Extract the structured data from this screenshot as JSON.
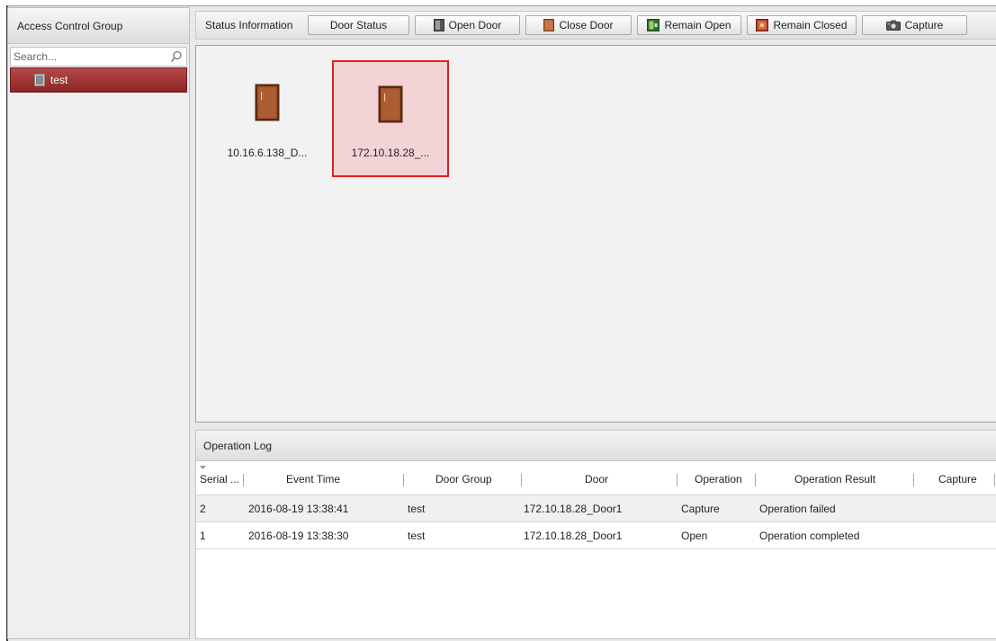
{
  "sidebar": {
    "title": "Access Control Group",
    "search_placeholder": "Search...",
    "groups": [
      {
        "label": "test"
      }
    ]
  },
  "toolbar": {
    "status_label": "Status Information",
    "buttons": {
      "door_status": "Door Status",
      "open_door": "Open Door",
      "close_door": "Close Door",
      "remain_open": "Remain Open",
      "remain_closed": "Remain Closed",
      "capture": "Capture"
    }
  },
  "doors": [
    {
      "label": "10.16.6.138_D...",
      "selected": false
    },
    {
      "label": "172.10.18.28_...",
      "selected": true
    }
  ],
  "log": {
    "title": "Operation Log",
    "columns": {
      "serial": "Serial ...",
      "event_time": "Event Time",
      "door_group": "Door Group",
      "door": "Door",
      "operation": "Operation",
      "result": "Operation Result",
      "capture": "Capture"
    },
    "rows": [
      {
        "serial": "2",
        "event_time": "2016-08-19 13:38:41",
        "door_group": "test",
        "door": "172.10.18.28_Door1",
        "operation": "Capture",
        "result": "Operation failed",
        "capture": ""
      },
      {
        "serial": "1",
        "event_time": "2016-08-19 13:38:30",
        "door_group": "test",
        "door": "172.10.18.28_Door1",
        "operation": "Open",
        "result": "Operation completed",
        "capture": ""
      }
    ]
  },
  "colors": {
    "selected_group": "#9e3030",
    "door_selected_border": "#e02020",
    "door_selected_fill": "#f3d3d6",
    "door_brown": "#a0522d"
  }
}
